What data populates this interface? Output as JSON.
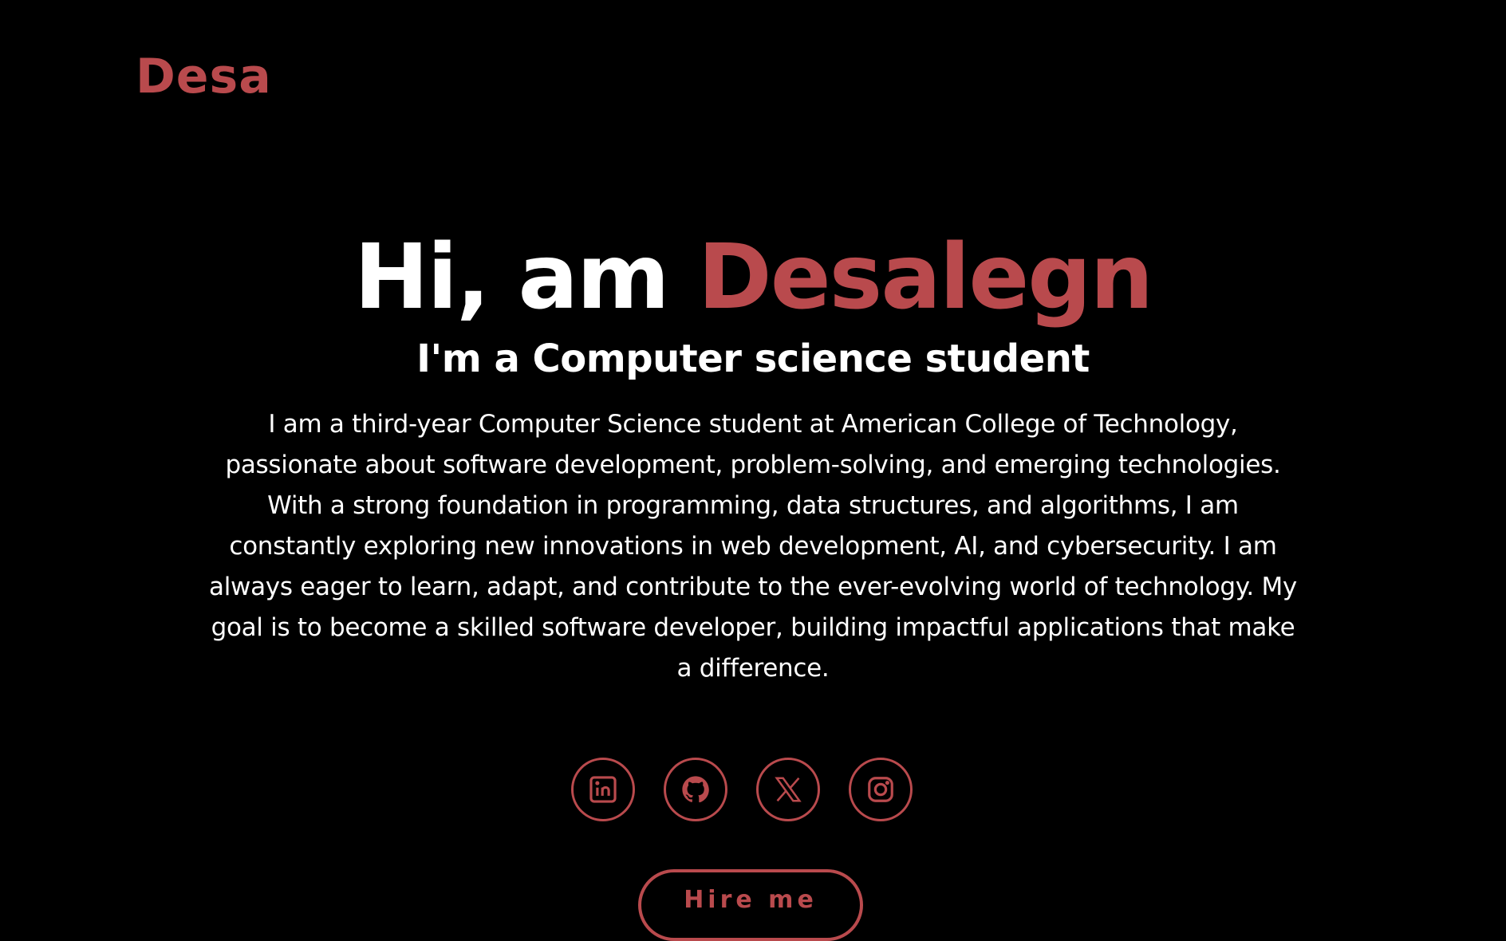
{
  "header": {
    "logo": "Desa"
  },
  "hero": {
    "greeting": "Hi, am ",
    "name": "Desalegn",
    "subtitle": "I'm a Computer science student",
    "bio": "I am a third-year Computer Science student at American College of Technology, passionate about software development, problem-solving, and emerging technologies. With a strong foundation in programming, data structures, and algorithms, I am constantly exploring new innovations in web development, AI, and cybersecurity. I am always eager to learn, adapt, and contribute to the ever-evolving world of technology. My goal is to become a skilled software developer, building impactful applications that make a difference."
  },
  "socials": [
    {
      "icon": "linkedin-icon"
    },
    {
      "icon": "github-icon"
    },
    {
      "icon": "x-icon"
    },
    {
      "icon": "instagram-icon"
    }
  ],
  "cta": {
    "hire_label": "Hire me"
  },
  "colors": {
    "accent": "#b94a4d",
    "background": "#000000",
    "text": "#ffffff"
  }
}
